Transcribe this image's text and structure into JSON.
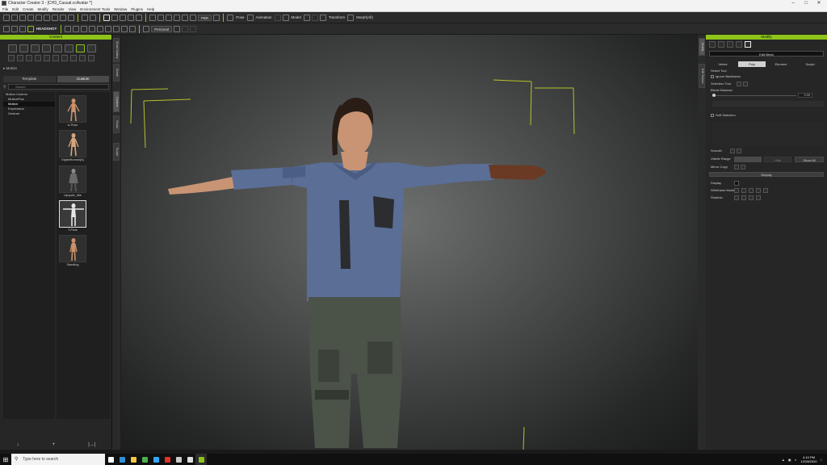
{
  "window": {
    "title": "Character Creator 3 - [CH3_Casual.ccAvatar *]",
    "controls": [
      "minimize-icon",
      "maximize-icon",
      "close-icon"
    ]
  },
  "menubar": [
    "File",
    "Edit",
    "Create",
    "Modify",
    "Render",
    "View",
    "Environment Tools",
    "Window",
    "Plugins",
    "Help"
  ],
  "toolbar": {
    "headshot_label": "HEADSHOT",
    "render_mode": "PBR",
    "pose_label": "Pose",
    "animation_label": "Animation",
    "model_label": "Model",
    "transform_label": "Transform",
    "morph_label": "Morph(All)",
    "view_mode": "Personal"
  },
  "left_panel": {
    "header": "Content",
    "path": "Motion",
    "tabs": [
      "Template",
      "Custom"
    ],
    "search_placeholder": "Search",
    "tree": [
      {
        "label": "Motion Custom",
        "selected": false
      },
      {
        "label": "MotionPlus",
        "selected": false
      },
      {
        "label": "Motion",
        "selected": true
      },
      {
        "label": "Expression",
        "selected": false
      },
      {
        "label": "Gesture",
        "selected": false
      }
    ],
    "thumbnails": [
      {
        "label": "A-Pose",
        "selected": false
      },
      {
        "label": "DigitalHuman(A)",
        "selected": false
      },
      {
        "label": "Upcycle_Idle",
        "selected": false
      },
      {
        "label": "T-Pose",
        "selected": true
      },
      {
        "label": "Standing",
        "selected": false
      }
    ],
    "bottom_buttons": [
      "↓",
      "+",
      "|→|"
    ]
  },
  "side_tabs_left": [
    "Smart Gallery",
    "Scene",
    "Content",
    "Visual",
    "Sculpt"
  ],
  "side_tabs_right": [
    "Modify",
    "Edit Texture"
  ],
  "right_panel": {
    "header": "Modify",
    "section_button": "Edit Mesh",
    "tabs": [
      "Vertex",
      "Poly",
      "Element",
      "Sculpt"
    ],
    "active_tab": "Poly",
    "select_tool_label": "Select Tool",
    "ignore_backfaces_label": "Ignore Backfaces",
    "selection_tool_label": "Selection Tool",
    "blend_distance_label": "Blend Distance",
    "blend_distance_value": "0.00",
    "soft_selection_label": "Soft Selection",
    "smooth_label": "Smooth",
    "visible_range_label": "Visible Range",
    "visible_range_buttons": [
      "Hide",
      "Show All"
    ],
    "mirror_copy_label": "Mirror Copy",
    "display_section": "Display",
    "display_rows": [
      "Display",
      "Wireframe Mode",
      "Shadow"
    ]
  },
  "taskbar": {
    "search_placeholder": "Type here to search",
    "time": "4:10 PM",
    "date": "12/28/2020",
    "apps": [
      {
        "name": "task-view-icon",
        "color": "#ffffff"
      },
      {
        "name": "edge-icon",
        "color": "#2f8fd8"
      },
      {
        "name": "file-explorer-icon",
        "color": "#f2c744"
      },
      {
        "name": "chrome-icon",
        "color": "#4caf50"
      },
      {
        "name": "photoshop-icon",
        "color": "#31a8ff"
      },
      {
        "name": "acrobat-icon",
        "color": "#e5322d"
      },
      {
        "name": "obs-icon",
        "color": "#cccccc"
      },
      {
        "name": "unreal-icon",
        "color": "#e0e0e0"
      },
      {
        "name": "character-creator-icon",
        "color": "#8ec31b"
      }
    ]
  },
  "colors": {
    "accent": "#8ec31b",
    "panel_bg": "#262626",
    "viewport_center": "#6e7070",
    "shirt": "#5a6e96",
    "pants": "#4b5248"
  }
}
